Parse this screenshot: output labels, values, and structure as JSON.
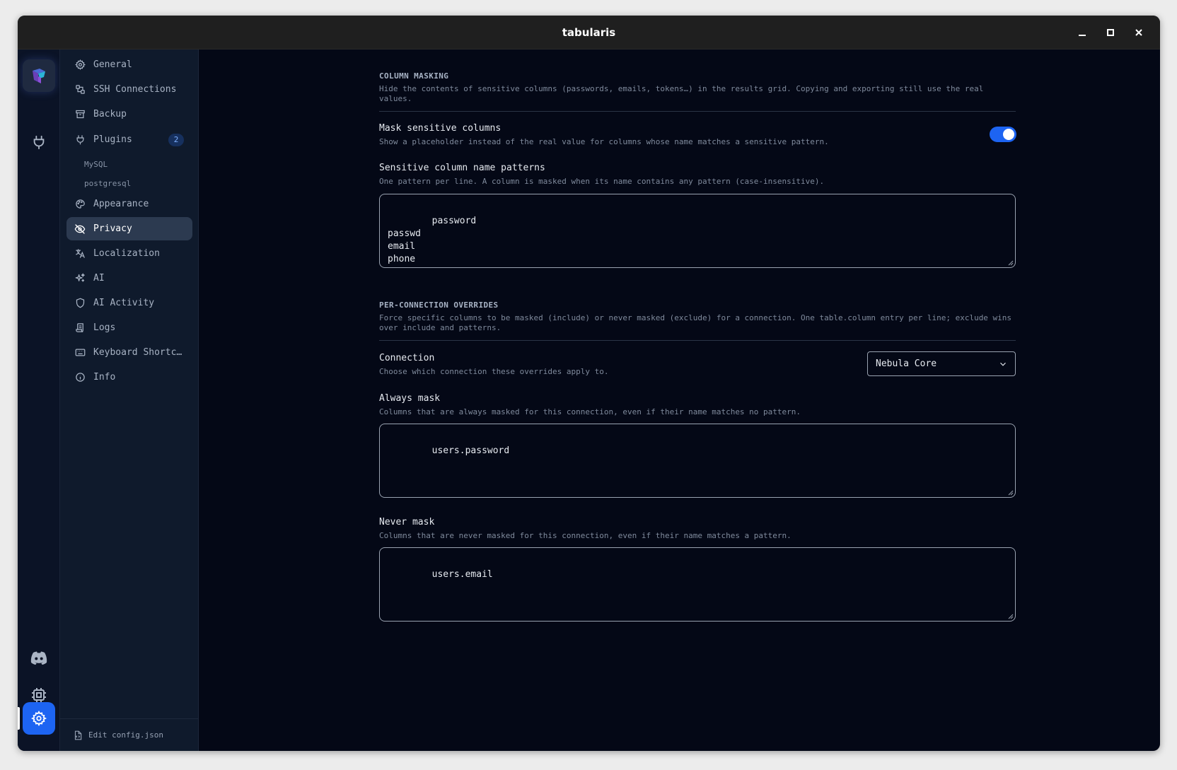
{
  "window": {
    "title": "tabularis"
  },
  "sidebar": {
    "items": [
      {
        "label": "General",
        "icon": "gear-icon"
      },
      {
        "label": "SSH Connections",
        "icon": "ssh-icon"
      },
      {
        "label": "Backup",
        "icon": "archive-icon"
      },
      {
        "label": "Plugins",
        "icon": "plug-icon",
        "badge": "2"
      },
      {
        "label": "Appearance",
        "icon": "palette-icon"
      },
      {
        "label": "Privacy",
        "icon": "eye-off-icon",
        "active": true
      },
      {
        "label": "Localization",
        "icon": "translate-icon"
      },
      {
        "label": "AI",
        "icon": "sparkles-icon"
      },
      {
        "label": "AI Activity",
        "icon": "shield-icon"
      },
      {
        "label": "Logs",
        "icon": "scroll-icon"
      },
      {
        "label": "Keyboard Shortc…",
        "icon": "keyboard-icon"
      },
      {
        "label": "Info",
        "icon": "info-icon"
      }
    ],
    "plugins": [
      "MySQL",
      "postgresql"
    ],
    "footer_label": "Edit config.json"
  },
  "column_masking": {
    "heading": "COLUMN MASKING",
    "description": "Hide the contents of sensitive columns (passwords, emails, tokens…) in the results grid. Copying and exporting still use the real values.",
    "mask_label": "Mask sensitive columns",
    "mask_desc": "Show a placeholder instead of the real value for columns whose name matches a sensitive pattern.",
    "mask_enabled": true,
    "patterns_label": "Sensitive column name patterns",
    "patterns_desc": "One pattern per line. A column is masked when its name contains any pattern (case-insensitive).",
    "patterns_value": "password\npasswd\nemail\nphone\nssn"
  },
  "overrides": {
    "heading": "PER-CONNECTION OVERRIDES",
    "description": "Force specific columns to be masked (include) or never masked (exclude) for a connection. One table.column entry per line; exclude wins over include and patterns.",
    "connection_label": "Connection",
    "connection_desc": "Choose which connection these overrides apply to.",
    "connection_value": "Nebula Core",
    "always_label": "Always mask",
    "always_desc": "Columns that are always masked for this connection, even if their name matches no pattern.",
    "always_value": "users.password",
    "never_label": "Never mask",
    "never_desc": "Columns that are never masked for this connection, even if their name matches a pattern.",
    "never_value": "users.email"
  },
  "colors": {
    "accent": "#1d64f2",
    "background": "#040816",
    "sidebar": "#0f1a2c"
  }
}
